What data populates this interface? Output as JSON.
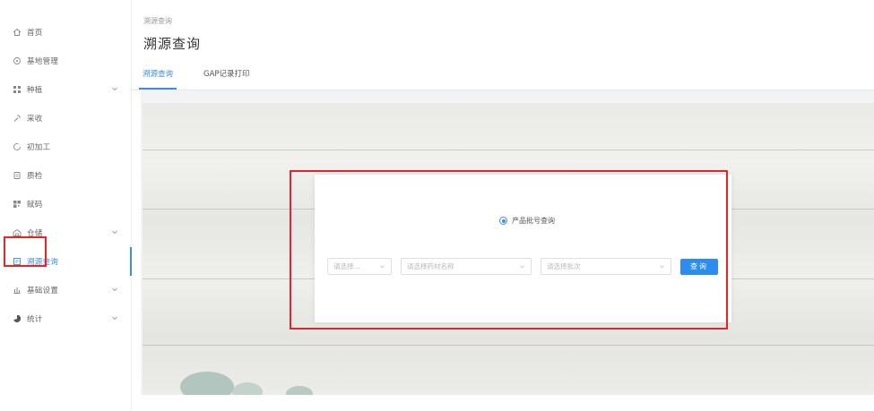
{
  "sidebar": {
    "items": [
      {
        "label": "首页",
        "icon": "home-icon",
        "has_chevron": false,
        "active": false
      },
      {
        "label": "基地管理",
        "icon": "location-icon",
        "has_chevron": false,
        "active": false
      },
      {
        "label": "种植",
        "icon": "grid-icon",
        "has_chevron": true,
        "active": false
      },
      {
        "label": "采收",
        "icon": "harvest-icon",
        "has_chevron": false,
        "active": false
      },
      {
        "label": "初加工",
        "icon": "process-icon",
        "has_chevron": false,
        "active": false
      },
      {
        "label": "质检",
        "icon": "inspect-icon",
        "has_chevron": false,
        "active": false
      },
      {
        "label": "赋码",
        "icon": "qrcode-icon",
        "has_chevron": false,
        "active": false
      },
      {
        "label": "仓储",
        "icon": "warehouse-icon",
        "has_chevron": true,
        "active": false
      },
      {
        "label": "溯源查询",
        "icon": "trace-icon",
        "has_chevron": false,
        "active": true
      },
      {
        "label": "基础设置",
        "icon": "settings-icon",
        "has_chevron": true,
        "active": false
      },
      {
        "label": "统计",
        "icon": "chart-icon",
        "has_chevron": true,
        "active": false
      }
    ]
  },
  "header": {
    "breadcrumb": "溯源查询",
    "title": "溯源查询"
  },
  "tabs": [
    {
      "label": "溯源查询",
      "active": true
    },
    {
      "label": "GAP记录打印",
      "active": false
    }
  ],
  "query": {
    "radio_label": "产品批号查询",
    "select_type_placeholder": "请选择...",
    "select_product_placeholder": "请选择药材名称",
    "select_batch_placeholder": "请选择批次",
    "button_label": "查询"
  },
  "colors": {
    "accent": "#3a8ee6",
    "button": "#2d8cf0",
    "highlight": "#e3242b"
  }
}
